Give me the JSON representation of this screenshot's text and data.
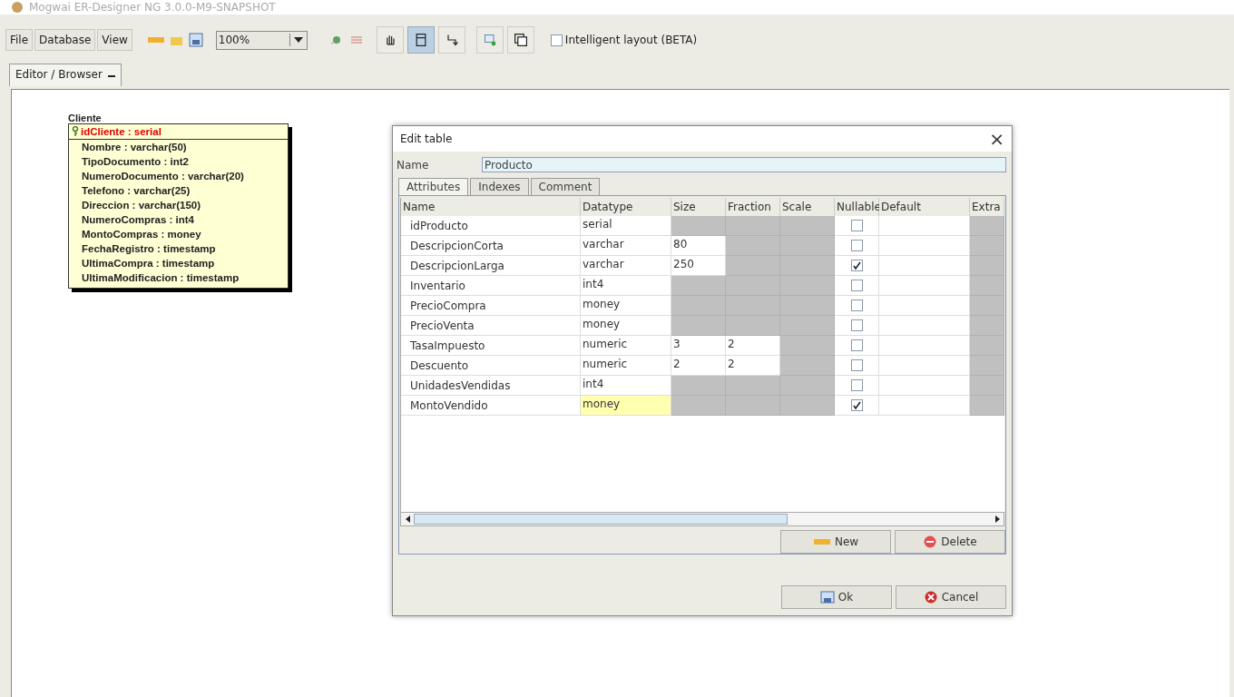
{
  "window": {
    "title": "Mogwai ER-Designer NG 3.0.0-M9-SNAPSHOT"
  },
  "menu": [
    "File",
    "Database",
    "View"
  ],
  "zoom": {
    "value": "100%"
  },
  "tools": [
    {
      "kind": "hand",
      "selected": false
    },
    {
      "kind": "table",
      "selected": true
    },
    {
      "kind": "relation",
      "selected": false
    },
    {
      "kind": "comment",
      "selected": false
    },
    {
      "kind": "subject",
      "selected": false
    }
  ],
  "intelligent_layout": {
    "label": "Intelligent layout (BETA)",
    "checked": false
  },
  "tabs": [
    {
      "label": "Editor / Browser"
    }
  ],
  "entity": {
    "name": "Cliente",
    "attributes": [
      {
        "text": "idCliente : serial",
        "primary_key": true
      },
      {
        "text": "Nombre : varchar(50)",
        "primary_key": false
      },
      {
        "text": "TipoDocumento : int2",
        "primary_key": false
      },
      {
        "text": "NumeroDocumento : varchar(20)",
        "primary_key": false
      },
      {
        "text": "Telefono : varchar(25)",
        "primary_key": false
      },
      {
        "text": "Direccion : varchar(150)",
        "primary_key": false
      },
      {
        "text": "NumeroCompras : int4",
        "primary_key": false
      },
      {
        "text": "MontoCompras : money",
        "primary_key": false
      },
      {
        "text": "FechaRegistro : timestamp",
        "primary_key": false
      },
      {
        "text": "UltimaCompra : timestamp",
        "primary_key": false
      },
      {
        "text": "UltimaModificacion : timestamp",
        "primary_key": false
      }
    ]
  },
  "dialog": {
    "title": "Edit table",
    "close": "×",
    "name_label": "Name",
    "name_value": "Producto",
    "tabs": [
      {
        "label": "Attributes",
        "selected": true
      },
      {
        "label": "Indexes",
        "selected": false
      },
      {
        "label": "Comment",
        "selected": false
      }
    ],
    "table": {
      "columns": [
        "Name",
        "Datatype",
        "Size",
        "Fraction",
        "Scale",
        "Nullable",
        "Default",
        "Extra"
      ],
      "rows": [
        {
          "name": "idProducto",
          "datatype": "serial",
          "nullable": false,
          "editing": false
        },
        {
          "name": "DescripcionCorta",
          "datatype": "varchar",
          "size": "80",
          "nullable": false,
          "editing": false
        },
        {
          "name": "DescripcionLarga",
          "datatype": "varchar",
          "size": "250",
          "nullable": true,
          "editing": false
        },
        {
          "name": "Inventario",
          "datatype": "int4",
          "nullable": false,
          "editing": false
        },
        {
          "name": "PrecioCompra",
          "datatype": "money",
          "nullable": false,
          "editing": false
        },
        {
          "name": "PrecioVenta",
          "datatype": "money",
          "nullable": false,
          "editing": false
        },
        {
          "name": "TasaImpuesto",
          "datatype": "numeric",
          "size": "3",
          "fraction": "2",
          "nullable": false,
          "editing": false
        },
        {
          "name": "Descuento",
          "datatype": "numeric",
          "size": "2",
          "fraction": "2",
          "nullable": false,
          "editing": false
        },
        {
          "name": "UnidadesVendidas",
          "datatype": "int4",
          "nullable": false,
          "editing": false
        },
        {
          "name": "MontoVendido",
          "datatype": "money",
          "nullable": true,
          "editing": true
        }
      ]
    },
    "table_buttons": [
      {
        "kind": "new",
        "label": "New"
      },
      {
        "kind": "delete",
        "label": "Delete"
      }
    ],
    "buttons": [
      {
        "kind": "ok",
        "label": "Ok"
      },
      {
        "kind": "cancel",
        "label": "Cancel"
      }
    ]
  }
}
